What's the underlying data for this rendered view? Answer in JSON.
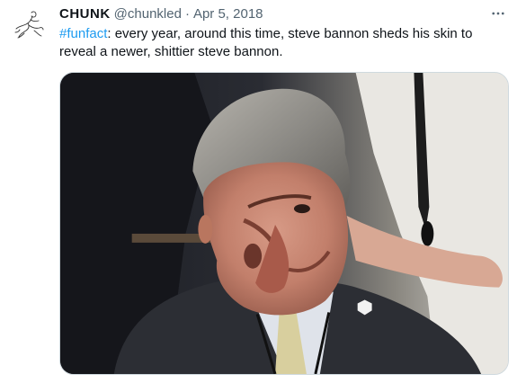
{
  "tweet": {
    "author": {
      "display_name": "CHUNK",
      "handle": "@chunkled",
      "avatar_icon": "abstract-figure-drawing"
    },
    "separator": "·",
    "date": "Apr 5, 2018",
    "more_icon": "more-options-icon",
    "text": {
      "hashtag": "#funfact",
      "body": ": every year, around this time, steve bannon sheds his skin to reveal a newer, shittier steve bannon."
    },
    "media": {
      "kind": "photo",
      "alt_icon": "distorted-portrait-photo"
    },
    "colors": {
      "link": "#1d9bf0",
      "secondary_text": "#536471",
      "primary_text": "#0f1419"
    }
  }
}
